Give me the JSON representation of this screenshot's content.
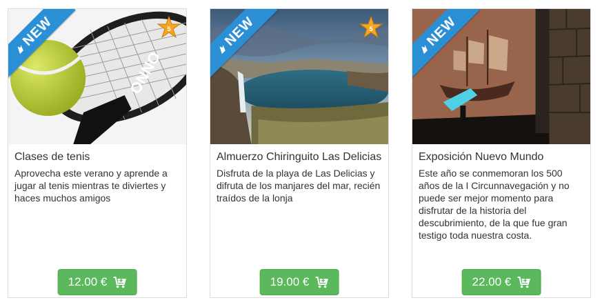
{
  "products": [
    {
      "title": "Clases de tenis",
      "description": "Aprovecha este verano y aprende a jugar al tenis mientras te diviertes y haces muchos amigos",
      "price": "12.00 €",
      "badge": "NEW",
      "rating_badge": "5"
    },
    {
      "title": "Almuerzo Chiringuito Las Delicias",
      "description": "Disfruta de la playa de Las Delicias y difruta de los manjares del mar, recién traídos de la lonja",
      "price": "19.00 €",
      "badge": "NEW",
      "rating_badge": "5"
    },
    {
      "title": "Exposición Nuevo Mundo",
      "description": "Este año se conmemoran los 500 años de la I Circunnavegación y no puede ser mejor momento para disfrutar de la historia del descubrimiento, de la que fue gran testigo toda nuestra costa.",
      "price": "22.00 €",
      "badge": "NEW"
    }
  ],
  "colors": {
    "ribbon": "#2b8fd6",
    "price_button": "#5cb85c",
    "star": "#f5a623"
  },
  "icons": {
    "badge": "new-ribbon-icon",
    "rating": "star-icon",
    "cart": "shopping-cart-icon"
  }
}
